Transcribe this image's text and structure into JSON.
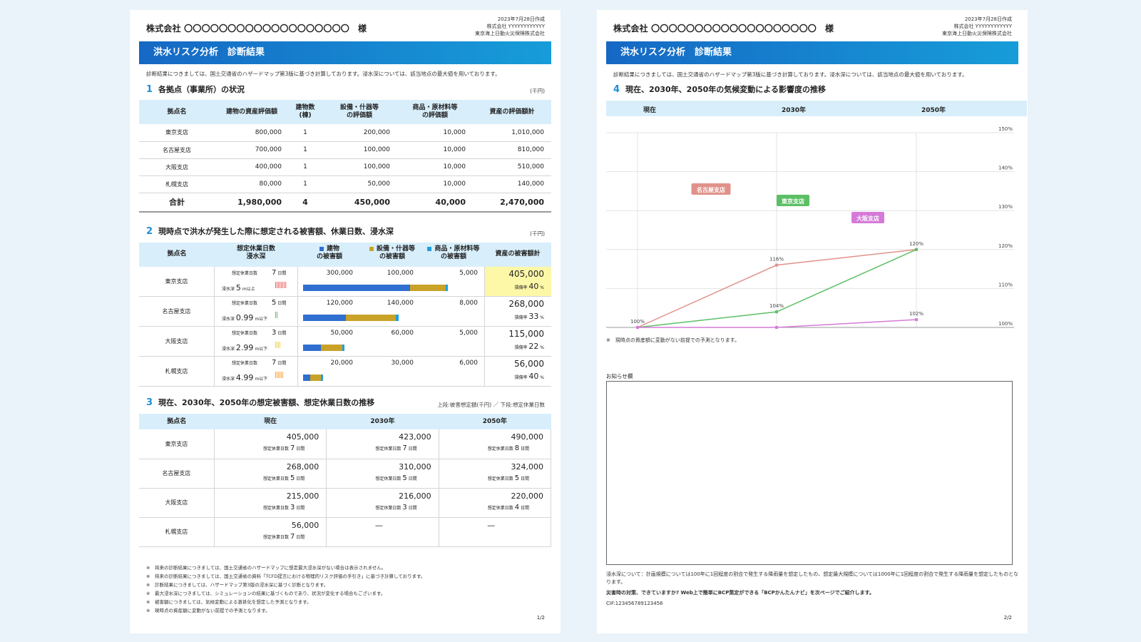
{
  "header": {
    "company": "株式会社 〇〇〇〇〇〇〇〇〇〇〇〇〇〇〇〇〇〇〇",
    "honorific": "様",
    "date": "2023年7月28日作成",
    "issuer": "株式会社 YYYYYYYYYYYY",
    "insurer": "東京海上日動火災保険株式会社"
  },
  "banner_title": "洪水リスク分析　診断結果",
  "intro": "診断結果につきましては、国土交通省のハザードマップ第3版に基づき計算しております。浸水深については、該当地点の最大値を用いております。",
  "section1": {
    "num": "1",
    "title": "各拠点（事業所）の状況",
    "unit": "(千円)",
    "headers": [
      "拠点名",
      "建物の資産評価額",
      "建物数\n(棟)",
      "設備・什器等\nの評価額",
      "商品・原材料等\nの評価額",
      "資産の評価額計"
    ],
    "rows": [
      [
        "東京支店",
        "800,000",
        "1",
        "200,000",
        "10,000",
        "1,010,000"
      ],
      [
        "名古屋支店",
        "700,000",
        "1",
        "100,000",
        "10,000",
        "810,000"
      ],
      [
        "大阪支店",
        "400,000",
        "1",
        "100,000",
        "10,000",
        "510,000"
      ],
      [
        "札幌支店",
        "80,000",
        "1",
        "50,000",
        "10,000",
        "140,000"
      ]
    ],
    "total": [
      "合計",
      "1,980,000",
      "4",
      "450,000",
      "40,000",
      "2,470,000"
    ]
  },
  "section2": {
    "num": "2",
    "title": "現時点で洪水が発生した際に想定される被害額、休業日数、浸水深",
    "unit": "(千円)",
    "headers": {
      "name": "拠点名",
      "days": "想定休業日数\n浸水深",
      "bldg": "建物\nの被害額",
      "equip": "設備・什器等\nの被害額",
      "goods": "商品・原材料等\nの被害額",
      "total": "資産の被害額計"
    },
    "days_label": "想定休業日数",
    "depth_label": "浸水深",
    "rate_label": "損傷率",
    "rows": [
      {
        "name": "東京支店",
        "days": "7",
        "days_unit": "日間",
        "depth": "5",
        "depth_unit": "m以上",
        "bldg": "300,000",
        "equip": "100,000",
        "goods": "5,000",
        "total": "405,000",
        "rate": "40",
        "highlight": true,
        "bldg_v": 300000,
        "equip_v": 100000,
        "goods_v": 5000,
        "ticks": "||||||||",
        "tick_color": "#e53935"
      },
      {
        "name": "名古屋支店",
        "days": "5",
        "days_unit": "日間",
        "depth": "0.99",
        "depth_unit": "m以下",
        "bldg": "120,000",
        "equip": "140,000",
        "goods": "8,000",
        "total": "268,000",
        "rate": "33",
        "highlight": false,
        "bldg_v": 120000,
        "equip_v": 140000,
        "goods_v": 8000,
        "ticks": "||",
        "tick_color": "#43a047"
      },
      {
        "name": "大阪支店",
        "days": "3",
        "days_unit": "日間",
        "depth": "2.99",
        "depth_unit": "m以下",
        "bldg": "50,000",
        "equip": "60,000",
        "goods": "5,000",
        "total": "115,000",
        "rate": "22",
        "highlight": false,
        "bldg_v": 50000,
        "equip_v": 60000,
        "goods_v": 5000,
        "ticks": "||||",
        "tick_color": "#f0c419"
      },
      {
        "name": "札幌支店",
        "days": "7",
        "days_unit": "日間",
        "depth": "4.99",
        "depth_unit": "m以下",
        "bldg": "20,000",
        "equip": "30,000",
        "goods": "6,000",
        "total": "56,000",
        "rate": "40",
        "highlight": false,
        "bldg_v": 20000,
        "equip_v": 30000,
        "goods_v": 6000,
        "ticks": "||||||",
        "tick_color": "#fb8c00"
      }
    ],
    "colors": {
      "bldg": "#2f6fd0",
      "equip": "#c9a227",
      "goods": "#1ea0e0"
    }
  },
  "section3": {
    "num": "3",
    "title": "現在、2030年、2050年の想定被害額、想定休業日数の推移",
    "note": "上段:被害想定額(千円) ／ 下段:想定休業日数",
    "headers": [
      "拠点名",
      "現在",
      "2030年",
      "2050年"
    ],
    "days_label": "想定休業日数",
    "days_unit": "日間",
    "rows": [
      {
        "name": "東京支店",
        "cells": [
          [
            "405,000",
            "7"
          ],
          [
            "423,000",
            "7"
          ],
          [
            "490,000",
            "8"
          ]
        ]
      },
      {
        "name": "名古屋支店",
        "cells": [
          [
            "268,000",
            "5"
          ],
          [
            "310,000",
            "5"
          ],
          [
            "324,000",
            "5"
          ]
        ]
      },
      {
        "name": "大阪支店",
        "cells": [
          [
            "215,000",
            "3"
          ],
          [
            "216,000",
            "3"
          ],
          [
            "220,000",
            "4"
          ]
        ]
      },
      {
        "name": "札幌支店",
        "cells": [
          [
            "56,000",
            "7"
          ],
          [
            "—",
            ""
          ],
          [
            "—",
            ""
          ]
        ]
      }
    ]
  },
  "notes": [
    "※　将来の診断結果につきましては、国土交通省のハザードマップに想定最大浸水深がない場合は表示されません。",
    "※　将来の診断結果につきましては、国土交通省の資料「TCFD提言における物理的リスク評価の手引き」に基づき計算しております。",
    "※　診断結果につきましては、ハザードマップ第3版の浸水深に基づく診断となります。",
    "※　最大浸水深につきましては、シミュレーションの結果に基づくものであり、状況が変化する場合もございます。",
    "※　被害額につきましては、気候変動による激甚化を想定した予測となります。",
    "※　現時点の資産額に変動がない前提での予測となります。"
  ],
  "page1": "1/2",
  "section4": {
    "num": "4",
    "title": "現在、2030年、2050年の気候変動による影響度の推移",
    "headers": [
      "現在",
      "2030年",
      "2050年"
    ]
  },
  "chart_data": {
    "type": "line",
    "categories": [
      "現在",
      "2030年",
      "2050年"
    ],
    "ylim": [
      100,
      150
    ],
    "yticks": [
      "100%",
      "110%",
      "120%",
      "130%",
      "140%",
      "150%"
    ],
    "grid": true,
    "series": [
      {
        "name": "名古屋支店",
        "values": [
          100,
          116,
          120
        ],
        "color": "#e0928a",
        "labels": [
          "100%",
          "116%",
          "120%"
        ]
      },
      {
        "name": "東京支店",
        "values": [
          100,
          104,
          120
        ],
        "color": "#5cbf65",
        "labels": [
          "",
          "104%",
          ""
        ]
      },
      {
        "name": "大阪支店",
        "values": [
          100,
          100,
          102
        ],
        "color": "#d57ad9",
        "labels": [
          "",
          "",
          "102%"
        ]
      }
    ]
  },
  "chart_note": "※　現時点の資産額に変動がない前提での予測となります。",
  "info_label": "お知らせ欄",
  "footer": {
    "depth_note": "浸水深について：計画規模については100年に1回程度の割合で発生する降雨量を想定したもの、想定最大規模については1000年に1回程度の割合で発生する降雨量を想定したものとなります。",
    "bcp": "災害時の対策、できていますか? Web上で簡単にBCP策定ができる「BCPかんたんナビ」を次ページでご紹介します。",
    "cif": "CIF:123456789123456"
  },
  "page2": "2/2"
}
